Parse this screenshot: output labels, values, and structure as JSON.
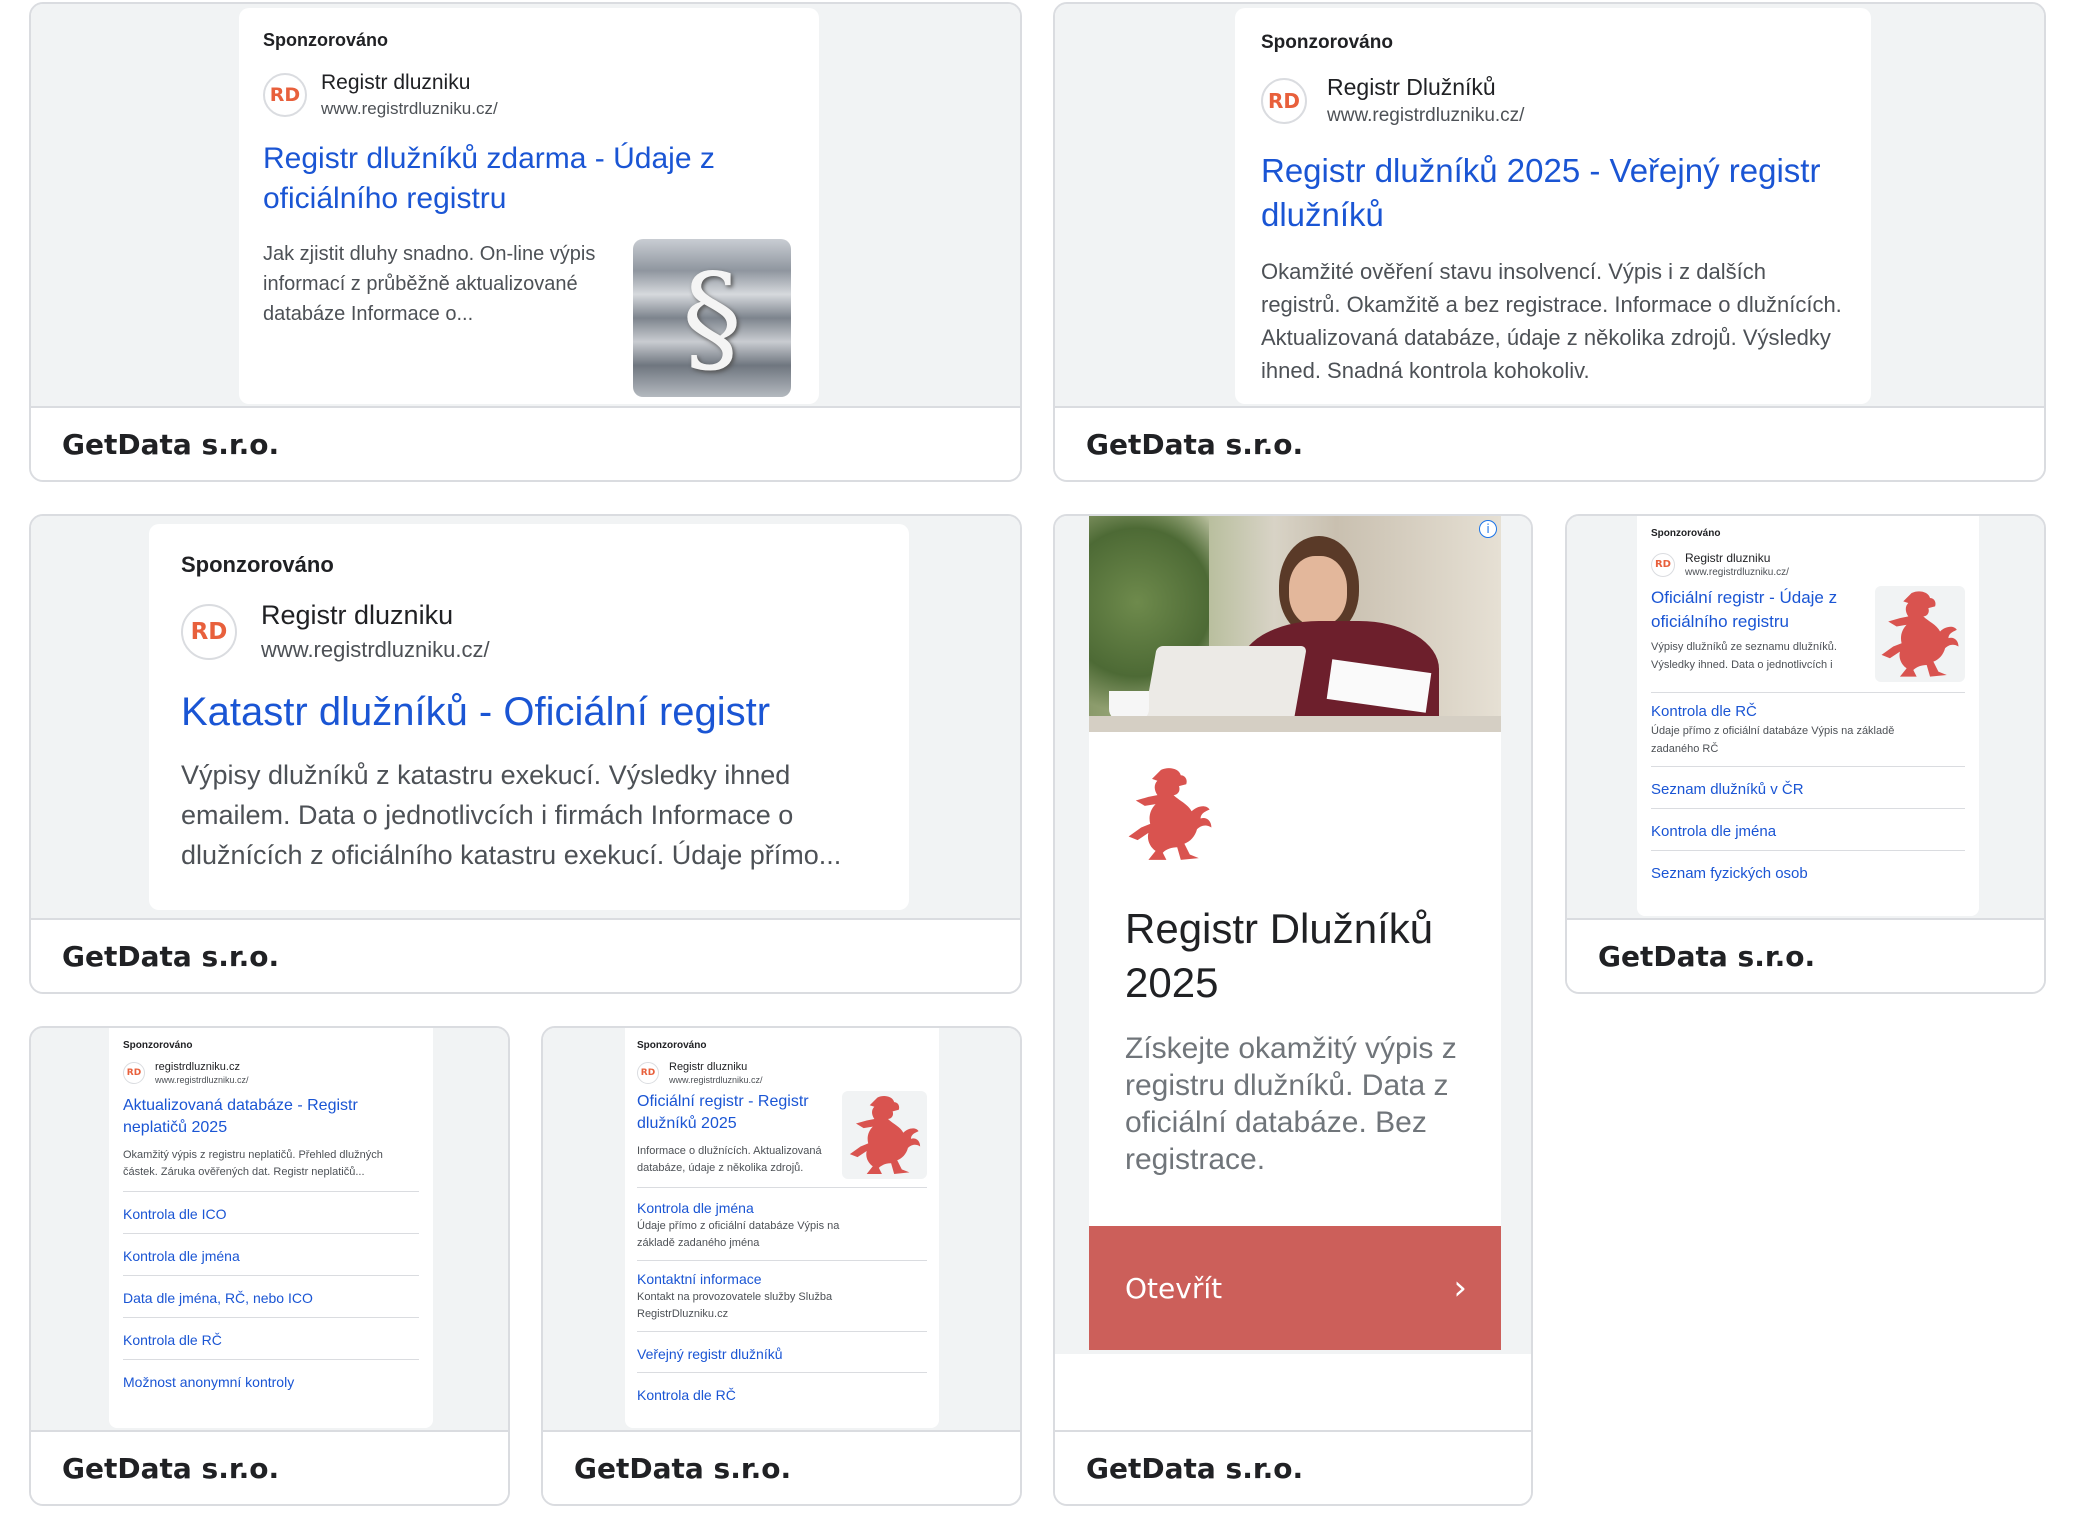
{
  "footer_label": "GetData s.r.o.",
  "sponsored_label": "Sponzorováno",
  "colors": {
    "link": "#1a55d4",
    "logo": "#e8603c",
    "lion": "#d9534f",
    "cta": "#cc5f5a"
  },
  "ads": {
    "a1": {
      "advertiser": "Registr dluzniku",
      "url": "www.registrdluzniku.cz/",
      "headline": "Registr dlužníků zdarma - Údaje z oficiálního registru",
      "description": "Jak zjistit dluhy snadno. On-line výpis informací z průběžně aktualizované databáze Informace o...",
      "image_icon": "paragraph-stack-photo"
    },
    "a2": {
      "advertiser": "Registr Dlužníků",
      "url": "www.registrdluzniku.cz/",
      "headline": "Registr dlužníků 2025 - Veřejný registr dlužníků",
      "description": "Okamžité ověření stavu insolvencí. Výpis i z dalších registrů. Okamžitě a bez registrace. Informace o dlužnících. Aktualizovaná databáze, údaje z několika zdrojů. Výsledky ihned. Snadná kontrola kohokoliv."
    },
    "a3": {
      "advertiser": "Registr dluzniku",
      "url": "www.registrdluzniku.cz/",
      "headline": "Katastr dlužníků - Oficiální registr",
      "description": "Výpisy dlužníků z katastru exekucí. Výsledky ihned emailem. Data o jednotlivcích i firmách Informace o dlužnících z oficiálního katastru exekucí. Údaje přímo..."
    },
    "a4": {
      "title": "Registr Dlužníků 2025",
      "description": "Získejte okamžitý výpis z registru dlužníků. Data z oficiální databáze. Bez registrace.",
      "cta": "Otevřít",
      "info_icon": "info-icon",
      "photo_icon": "woman-at-laptop-photo"
    },
    "a5": {
      "advertiser": "Registr dluzniku",
      "url": "www.registrdluzniku.cz/",
      "headline": "Oficiální registr - Údaje z oficiálního registru",
      "description": "Výpisy dlužníků ze seznamu dlužníků. Výsledky ihned. Data o jednotlivcích i firmách",
      "sitelinks": [
        {
          "title": "Kontrola dle RČ",
          "desc": "Údaje přímo z oficiální databáze Výpis na základě zadaného RČ"
        },
        {
          "title": "Seznam dlužníků v ČR",
          "desc": ""
        },
        {
          "title": "Kontrola dle jména",
          "desc": ""
        },
        {
          "title": "Seznam fyzických osob",
          "desc": ""
        }
      ]
    },
    "a6": {
      "advertiser": "registrdluzniku.cz",
      "url": "www.registrdluzniku.cz/",
      "headline": "Aktualizovaná databáze - Registr neplatičů 2025",
      "description": "Okamžitý výpis z registru neplatičů. Přehled dlužných částek. Záruka ověřených dat. Registr neplatičů...",
      "sitelinks": [
        {
          "title": "Kontrola dle ICO",
          "desc": ""
        },
        {
          "title": "Kontrola dle jména",
          "desc": ""
        },
        {
          "title": "Data dle jména, RČ, nebo ICO",
          "desc": ""
        },
        {
          "title": "Kontrola dle RČ",
          "desc": ""
        },
        {
          "title": "Možnost anonymní kontroly",
          "desc": ""
        }
      ]
    },
    "a7": {
      "advertiser": "Registr dluzniku",
      "url": "www.registrdluzniku.cz/",
      "headline": "Oficiální registr - Registr dlužníků 2025",
      "description": "Informace o dlužnících. Aktualizovaná databáze, údaje z několika zdrojů. Výsledky ihned. Registr",
      "sitelinks": [
        {
          "title": "Kontrola dle jména",
          "desc": "Údaje přímo z oficiální databáze Výpis na základě zadaného jména"
        },
        {
          "title": "Kontaktní informace",
          "desc": "Kontakt na provozovatele služby Služba RegistrDluzniku.cz"
        },
        {
          "title": "Veřejný registr dlužníků",
          "desc": ""
        },
        {
          "title": "Kontrola dle RČ",
          "desc": ""
        }
      ]
    }
  }
}
